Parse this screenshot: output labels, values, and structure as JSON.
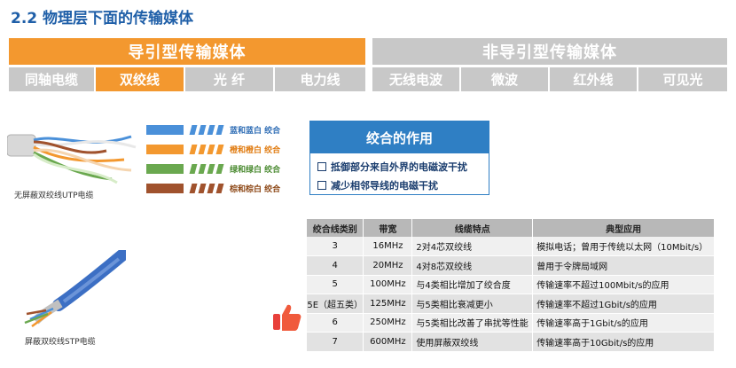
{
  "title": "2.2 物理层下面的传输媒体",
  "categories": {
    "guided": "导引型传输媒体",
    "unguided": "非导引型传输媒体"
  },
  "guided_media": [
    "同轴电缆",
    "双绞线",
    "光  纤",
    "电力线"
  ],
  "unguided_media": [
    "无线电波",
    "微波",
    "红外线",
    "可见光"
  ],
  "captions": {
    "utp": "无屏蔽双绞线UTP电缆",
    "stp": "屏蔽双绞线STP电缆"
  },
  "pairs": [
    {
      "label": "蓝和蓝白 绞合",
      "color": "#4a90d9"
    },
    {
      "label": "橙和橙白 绞合",
      "color": "#f3982f"
    },
    {
      "label": "绿和绿白 绞合",
      "color": "#6aa84f"
    },
    {
      "label": "棕和棕白 绞合",
      "color": "#a0522d"
    }
  ],
  "function_box": {
    "title": "绞合的作用",
    "items": [
      "抵御部分来自外界的电磁波干扰",
      "减少相邻导线的电磁干扰"
    ]
  },
  "table": {
    "headers": [
      "绞合线类别",
      "带宽",
      "线缆特点",
      "典型应用"
    ],
    "rows": [
      [
        "3",
        "16MHz",
        "2对4芯双绞线",
        "模拟电话；曾用于传统以太网（10Mbit/s）"
      ],
      [
        "4",
        "20MHz",
        "4对8芯双绞线",
        "曾用于令牌局域网"
      ],
      [
        "5",
        "100MHz",
        "与4类相比增加了绞合度",
        "传输速率不超过100Mbit/s的应用"
      ],
      [
        "5E（超五类）",
        "125MHz",
        "与5类相比衰减更小",
        "传输速率不超过1Gbit/s的应用"
      ],
      [
        "6",
        "250MHz",
        "与5类相比改善了串扰等性能",
        "传输速率高于1Gbit/s的应用"
      ],
      [
        "7",
        "600MHz",
        "使用屏蔽双绞线",
        "传输速率高于10Gbit/s的应用"
      ]
    ]
  }
}
